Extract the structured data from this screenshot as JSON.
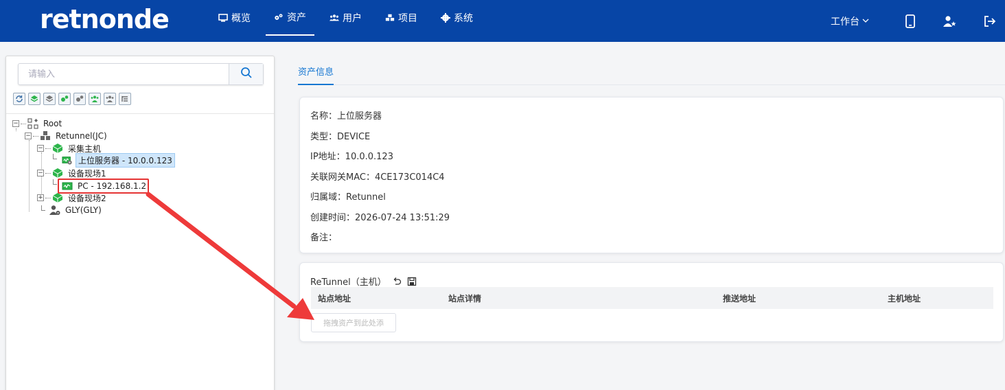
{
  "header": {
    "logo": "retnonde",
    "nav": [
      {
        "label": "概览",
        "icon": "monitor-icon"
      },
      {
        "label": "资产",
        "icon": "gears-icon",
        "active": true
      },
      {
        "label": "用户",
        "icon": "users-icon"
      },
      {
        "label": "项目",
        "icon": "cubes-icon"
      },
      {
        "label": "系统",
        "icon": "gear-icon"
      }
    ],
    "workbench": "工作台",
    "right_icons": [
      "mobile-icon",
      "user-star-icon",
      "logout-icon"
    ]
  },
  "colors": {
    "header_bg": "#0745a6",
    "accent": "#1677d2",
    "highlight_red": "#e53333",
    "node_green": "#2db54b"
  },
  "sidebar": {
    "search_placeholder": "请输入",
    "toolbar": [
      "refresh-icon",
      "layer-green-icon",
      "layer-gray-icon",
      "gears-green-icon",
      "gears-gray-icon",
      "users-green-icon",
      "users-gray-icon",
      "list-icon"
    ],
    "tree": {
      "root": "Root",
      "domain": "Retunnel(JC)",
      "group1": "采集主机",
      "group1_child": "上位服务器 - 10.0.0.123",
      "group2": "设备现场1",
      "group2_child": "PC - 192.168.1.2",
      "group3": "设备现场2",
      "user": "GLY(GLY)"
    }
  },
  "main": {
    "tab": "资产信息",
    "info": {
      "name": "名称：上位服务器",
      "type": "类型：DEVICE",
      "ip": "IP地址：10.0.0.123",
      "mac": "关联网关MAC：4CE173C014C4",
      "domain": "归属域：Retunnel",
      "created": "创建时间：2026-07-24 13:51:29",
      "remark": "备注："
    },
    "tunnel": {
      "title": "ReTunnel（主机）",
      "columns": [
        "站点地址",
        "站点详情",
        "推送地址",
        "主机地址"
      ],
      "drop_hint": "拖拽资产到此处添"
    }
  }
}
